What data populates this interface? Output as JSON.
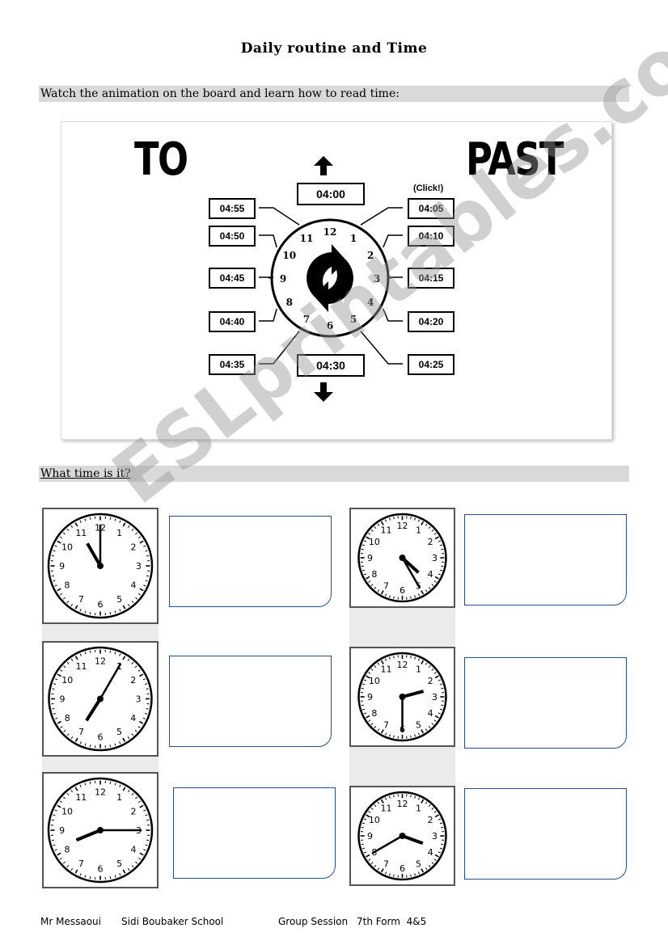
{
  "title": "Daily routine and Time",
  "section1": "Watch the animation on the board and learn how to read time:",
  "diagram": {
    "to_label": "TO",
    "past_label": "PAST",
    "click_label": "(Click!)",
    "top": "04:00",
    "bottom": "04:30",
    "left": [
      "04:55",
      "04:50",
      "04:45",
      "04:40",
      "04:35"
    ],
    "right": [
      "04:05",
      "04:10",
      "04:15",
      "04:20",
      "04:25"
    ],
    "numbers": [
      "12",
      "1",
      "2",
      "3",
      "4",
      "5",
      "6",
      "7",
      "8",
      "9",
      "10",
      "11"
    ],
    "icon": "refresh-arrows-icon"
  },
  "section2": "What time is it?",
  "clocks": [
    {
      "hour": 11,
      "minute": 0
    },
    {
      "hour": 4,
      "minute": 25
    },
    {
      "hour": 7,
      "minute": 5
    },
    {
      "hour": 2,
      "minute": 30
    },
    {
      "hour": 8,
      "minute": 15
    },
    {
      "hour": 3,
      "minute": 40
    }
  ],
  "footer": {
    "teacher": "Mr Messaoui",
    "school": "Sidi Boubaker School",
    "session": "Group Session",
    "form": "7th Form  4&5"
  },
  "watermark": "ESLprintables.com"
}
